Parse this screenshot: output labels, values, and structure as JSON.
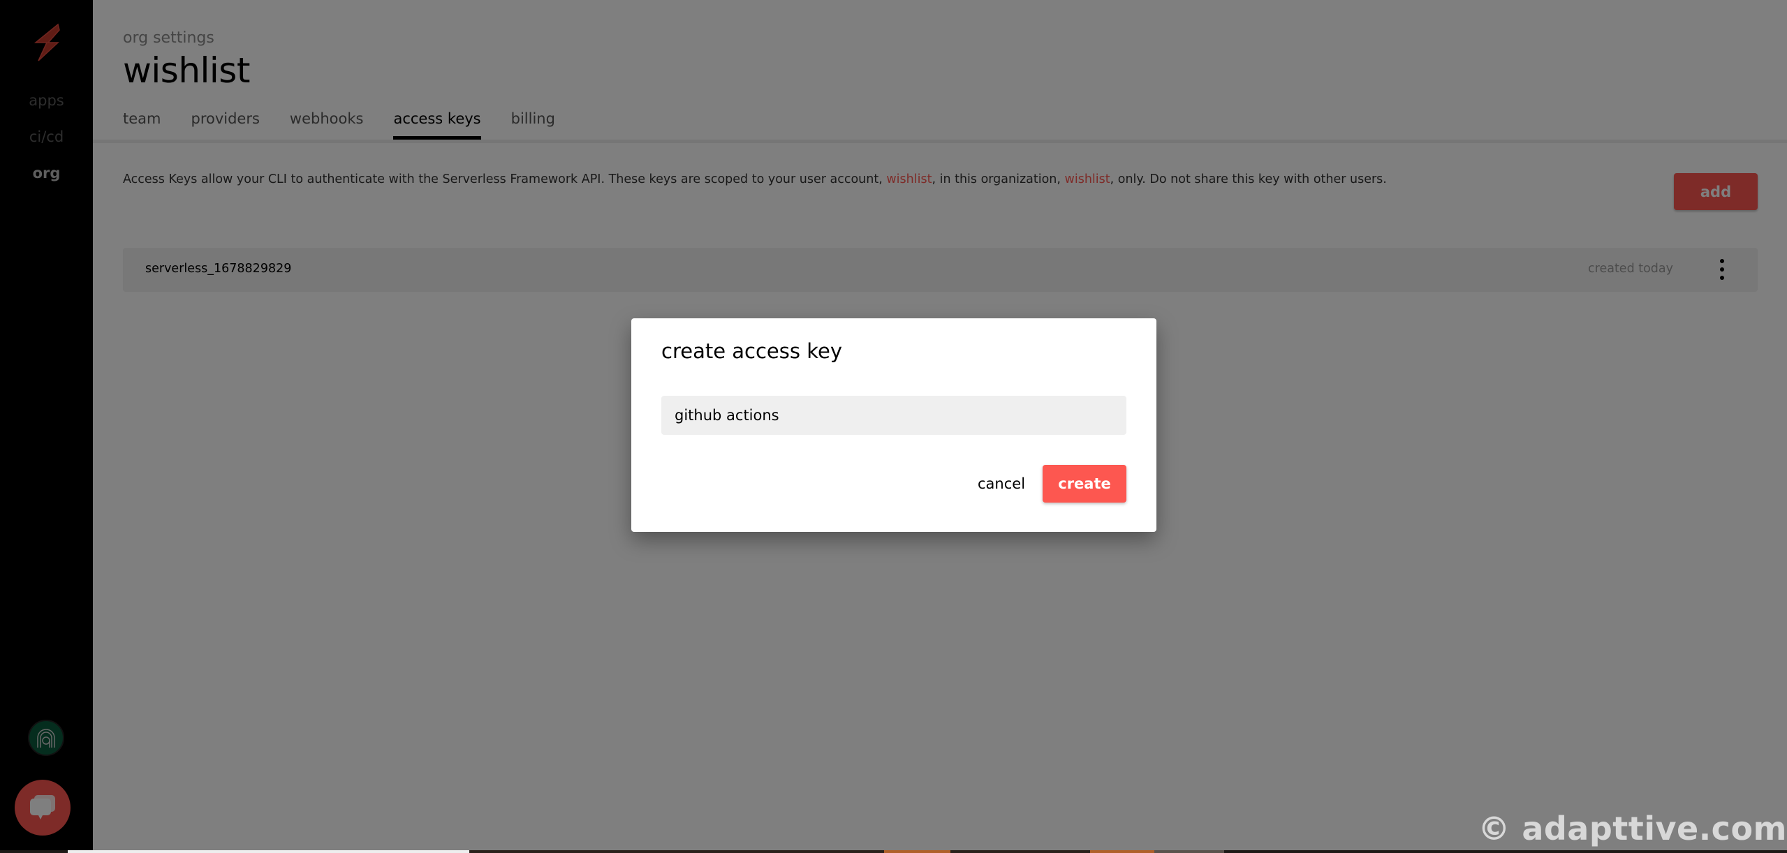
{
  "sidebar": {
    "logo_icon": "lightning-bolt-icon",
    "items": [
      {
        "label": "apps",
        "active": false
      },
      {
        "label": "ci/cd",
        "active": false
      },
      {
        "label": "org",
        "active": true
      }
    ],
    "avatar_icon": "user-avatar-icon",
    "chat_icon": "chat-bubble-icon"
  },
  "header": {
    "eyebrow": "org settings",
    "title": "wishlist"
  },
  "tabs": [
    {
      "label": "team",
      "active": false
    },
    {
      "label": "providers",
      "active": false
    },
    {
      "label": "webhooks",
      "active": false
    },
    {
      "label": "access keys",
      "active": true
    },
    {
      "label": "billing",
      "active": false
    }
  ],
  "description": {
    "part1": "Access Keys allow your CLI to authenticate with the Serverless Framework API. These keys are scoped to your user account, ",
    "user": "wishlist",
    "part2": ", in this organization, ",
    "org": "wishlist",
    "part3": ", only. Do not share this key with other users."
  },
  "add_button_label": "add",
  "access_keys": [
    {
      "name": "serverless_1678829829",
      "created": "created today",
      "menu_icon": "kebab-menu-icon"
    }
  ],
  "modal": {
    "title": "create access key",
    "input_value": "github actions",
    "cancel_label": "cancel",
    "create_label": "create"
  },
  "watermark": "© adapttive.com",
  "colors": {
    "accent": "#fd5750",
    "sidebar_bg": "#000000",
    "overlay": "rgba(0,0,0,0.5)"
  }
}
